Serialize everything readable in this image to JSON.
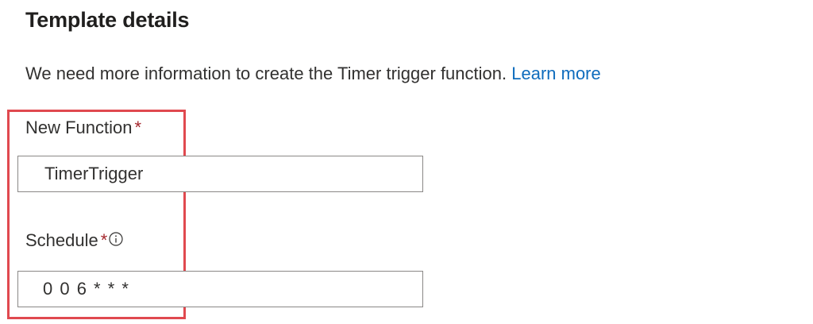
{
  "section": {
    "title": "Template details",
    "description": "We need more information to create the Timer trigger function.",
    "learn_more": "Learn more"
  },
  "fields": {
    "function": {
      "label": "New Function",
      "required": "*",
      "value": "TimerTrigger"
    },
    "schedule": {
      "label": "Schedule",
      "required": "*",
      "value": "0 0 6 * * *",
      "info_icon": "info-icon"
    }
  },
  "colors": {
    "link": "#0f6cbd",
    "required": "#a4262c",
    "highlight": "#e0494f",
    "input_border": "#8a8886"
  }
}
